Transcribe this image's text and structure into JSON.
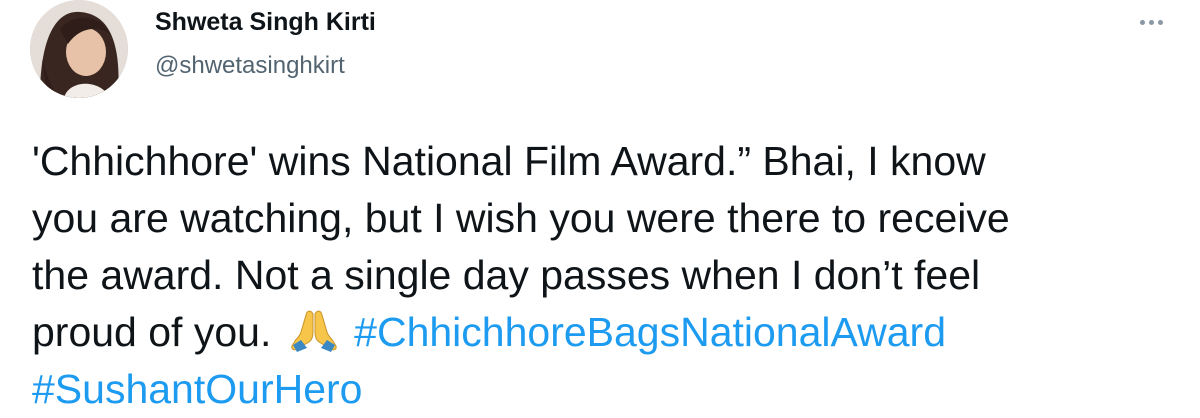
{
  "author": {
    "display_name": "Shweta Singh Kirti",
    "handle": "@shwetasinghkirt",
    "avatar_icon": "profile-photo"
  },
  "more_menu_icon": "more-horizontal-icon",
  "tweet": {
    "line1": "'Chhichhore' wins National Film Award.” Bhai, I know",
    "line2": "you are watching, but I wish you were there to receive",
    "line3": "the award. Not a single day passes when I don’t feel",
    "line4_text": "proud of you.",
    "emoji_icon": "folded-hands-icon",
    "hashtags": [
      "#ChhichhoreBagsNationalAward",
      "#SushantOurHero"
    ]
  },
  "colors": {
    "text": "#0f1419",
    "secondary": "#536471",
    "link": "#1d9bf0"
  }
}
